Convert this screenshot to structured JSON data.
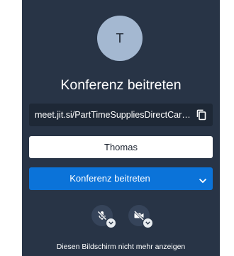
{
  "prejoin": {
    "avatar_initial": "T",
    "title": "Konferenz beitreten",
    "meeting_url": "meet.jit.si/PartTimeSuppliesDirectCar…",
    "copy_icon": "copy-icon",
    "name_input_value": "Thomas",
    "join_button_label": "Konferenz beitreten",
    "join_options_icon": "chevron-down-icon",
    "mic_button_icon": "microphone-muted-icon",
    "camera_button_icon": "camera-off-icon",
    "footer_text": "Diesen Bildschirm nicht mehr anzeigen"
  },
  "colors": {
    "panel_bg": "#283446",
    "url_bg": "#1e2836",
    "avatar_bg": "#a4b8d1",
    "accent": "#0b73d9",
    "media_btn_bg": "#36445a"
  }
}
